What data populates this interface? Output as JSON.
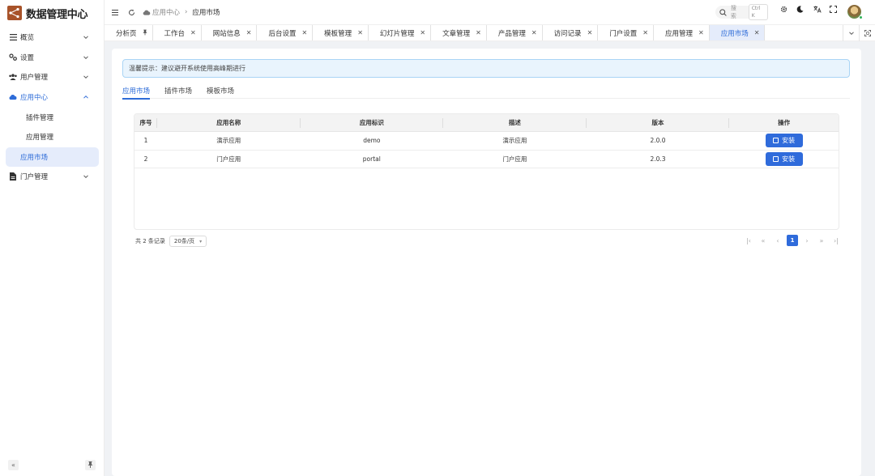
{
  "app": {
    "title": "数据管理中心"
  },
  "sidebar": {
    "items": [
      {
        "label": "概览",
        "icon": "list-icon",
        "expandable": true
      },
      {
        "label": "设置",
        "icon": "settings-icon",
        "expandable": true
      },
      {
        "label": "用户管理",
        "icon": "users-icon",
        "expandable": true
      },
      {
        "label": "应用中心",
        "icon": "cloud-icon",
        "expandable": true,
        "open": true,
        "children": [
          {
            "label": "插件管理"
          },
          {
            "label": "应用管理"
          },
          {
            "label": "应用市场",
            "active": true
          }
        ]
      },
      {
        "label": "门户管理",
        "icon": "document-icon",
        "expandable": true
      }
    ]
  },
  "header": {
    "breadcrumb": {
      "parent": "应用中心",
      "current": "应用市场"
    },
    "search": {
      "placeholder": "搜索",
      "shortcut": "Ctrl K"
    }
  },
  "tabs": [
    {
      "label": "分析页",
      "pinned": true
    },
    {
      "label": "工作台"
    },
    {
      "label": "网站信息"
    },
    {
      "label": "后台设置"
    },
    {
      "label": "模板管理"
    },
    {
      "label": "幻灯片管理"
    },
    {
      "label": "文章管理"
    },
    {
      "label": "产品管理"
    },
    {
      "label": "访问记录"
    },
    {
      "label": "门户设置"
    },
    {
      "label": "应用管理"
    },
    {
      "label": "应用市场",
      "active": true
    }
  ],
  "notice": {
    "text": "温馨提示：建议避开系统使用高峰期进行"
  },
  "subtabs": [
    {
      "label": "应用市场",
      "active": true
    },
    {
      "label": "插件市场"
    },
    {
      "label": "模板市场"
    }
  ],
  "table": {
    "columns": [
      "序号",
      "应用名称",
      "应用标识",
      "描述",
      "版本",
      "操作"
    ],
    "rows": [
      {
        "index": "1",
        "name": "演示应用",
        "id": "demo",
        "desc": "演示应用",
        "version": "2.0.0",
        "action": "安装"
      },
      {
        "index": "2",
        "name": "门户应用",
        "id": "portal",
        "desc": "门户应用",
        "version": "2.0.3",
        "action": "安装"
      }
    ]
  },
  "pagination": {
    "total_text": "共 2 条记录",
    "page_size": "20条/页",
    "current_page": "1"
  },
  "colors": {
    "accent": "#2e6cd8",
    "brand": "#a8532a",
    "notice_bg": "#e9f4fd"
  }
}
